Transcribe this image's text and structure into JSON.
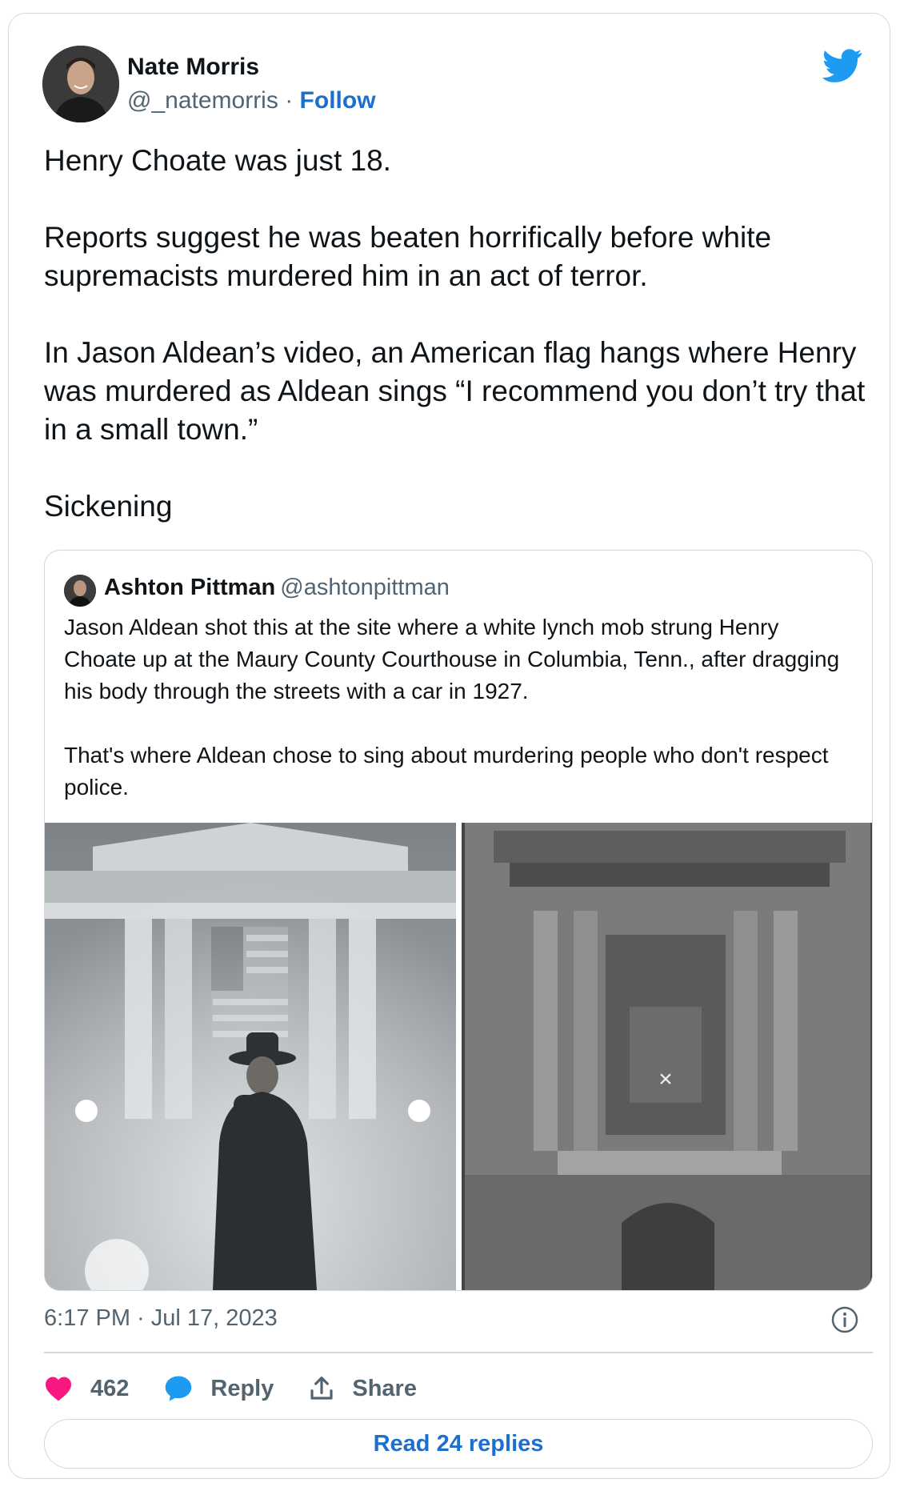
{
  "author": {
    "name": "Nate Morris",
    "handle": "@_natemorris",
    "separator": "·",
    "follow_label": "Follow"
  },
  "tweet": {
    "paragraphs": [
      "Henry Choate was just 18.",
      "Reports suggest he was beaten horrifically before white supremacists murdered him in an act of terror.",
      "In Jason Aldean’s video, an American flag hangs where Henry was murdered as Aldean sings “I recommend you don’t try that in a small town.”",
      "Sickening"
    ]
  },
  "quoted": {
    "name": "Ashton Pittman",
    "handle": "@ashtonpittman",
    "paragraphs": [
      "Jason Aldean shot this at the site where a white lynch mob strung Henry Choate up at the Maury County Courthouse in Columbia, Tenn., after dragging his body through the streets with a car in 1927.",
      "That's where Aldean chose to sing about murdering people who don't respect police."
    ]
  },
  "timestamp": "6:17 PM · Jul 17, 2023",
  "actions": {
    "likes": "462",
    "reply_label": "Reply",
    "share_label": "Share"
  },
  "read_replies_label": "Read 24 replies",
  "colors": {
    "like": "#f91880",
    "reply": "#1d9bf0",
    "link": "#1d6fcc",
    "twitter_blue": "#1d9bf0"
  },
  "icons": [
    "twitter-bird-icon",
    "info-icon",
    "heart-icon",
    "speech-bubble-icon",
    "share-upload-icon"
  ]
}
